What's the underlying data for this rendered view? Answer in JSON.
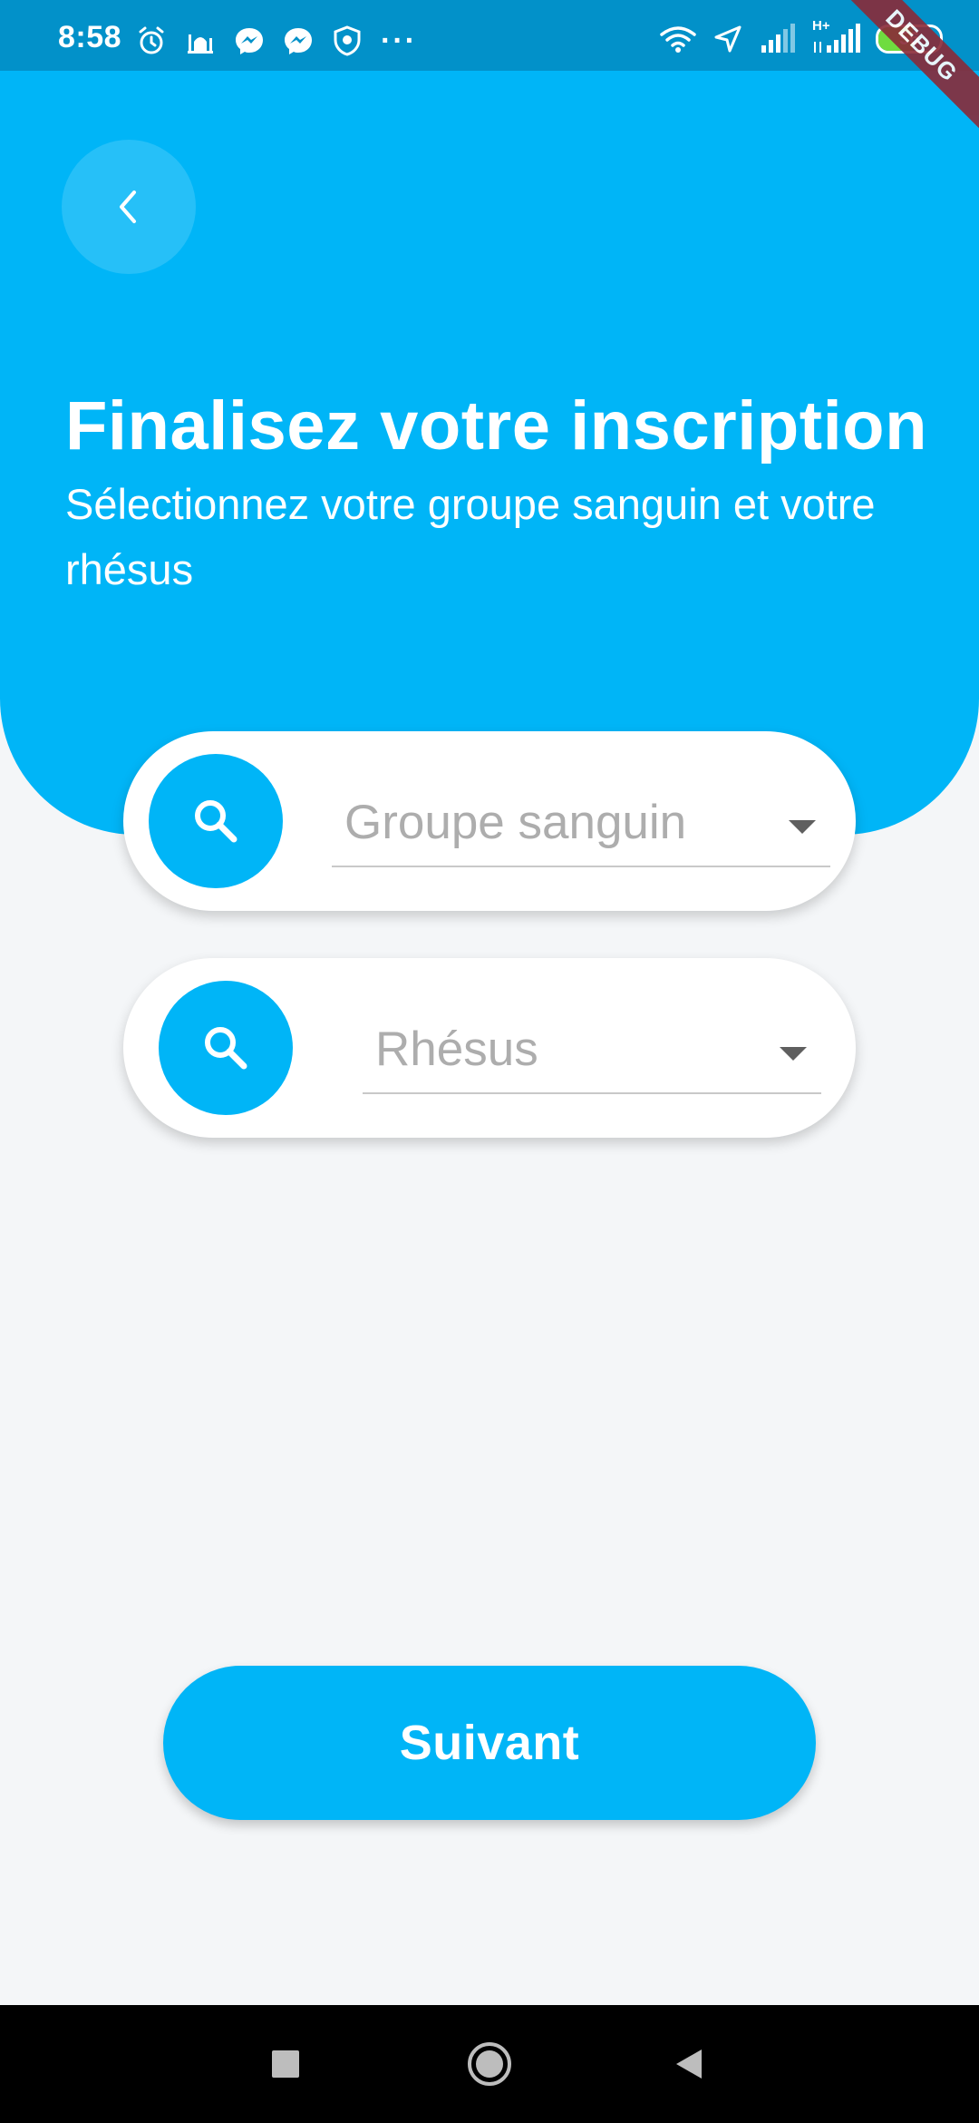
{
  "status_bar": {
    "time": "8:58",
    "battery_level": "56",
    "debug_label": "DEBUG",
    "left_icons": [
      "alarm-icon",
      "mosque-icon",
      "messenger-icon",
      "messenger-icon",
      "shield-icon",
      "more-dots-icon"
    ],
    "right_icons": [
      "wifi-icon",
      "location-icon",
      "signal-icon",
      "signal-h-plus-icon",
      "battery-icon"
    ],
    "network_label": "H+"
  },
  "header": {
    "title": "Finalisez votre inscription",
    "subtitle": "Sélectionnez votre groupe sanguin et votre rhésus",
    "back_icon": "chevron-left-icon"
  },
  "form": {
    "blood_group": {
      "placeholder": "Groupe sanguin",
      "icon": "search-icon"
    },
    "rhesus": {
      "placeholder": "Rhésus",
      "icon": "search-icon"
    }
  },
  "actions": {
    "next_label": "Suivant"
  },
  "nav": {
    "items": [
      "recent-apps-icon",
      "home-icon",
      "back-icon"
    ]
  },
  "colors": {
    "primary": "#00b5f7",
    "status_bar": "#0291c9",
    "background": "#f4f6f8",
    "battery_fill": "#6fdc3f",
    "debug_ribbon": "#8a2a38"
  }
}
